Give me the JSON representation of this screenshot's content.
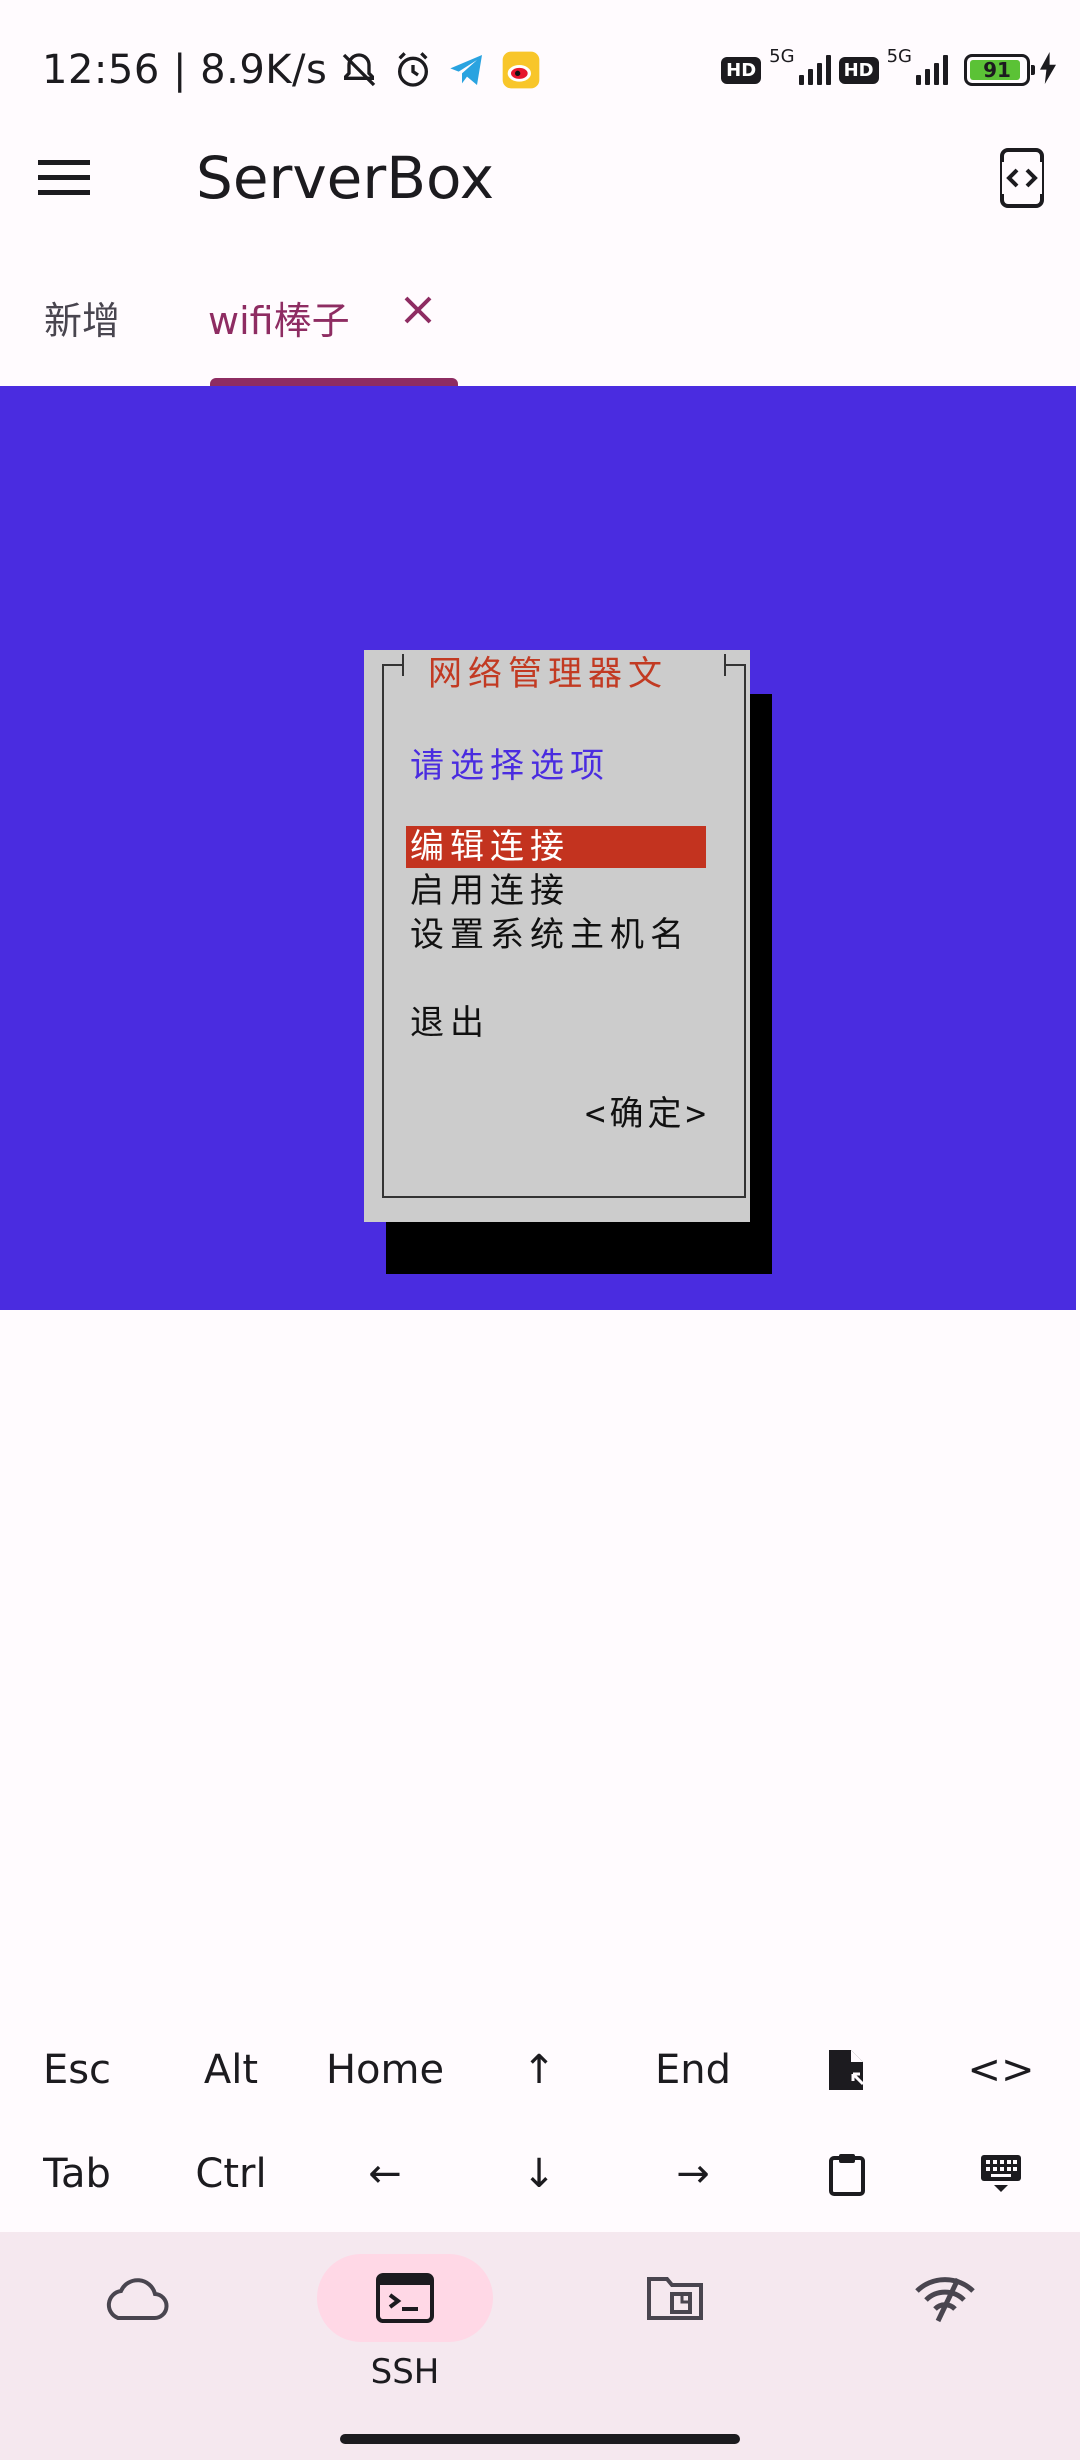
{
  "status_bar": {
    "time_speed": "12:56 | 8.9K/s",
    "network_1": "5G",
    "network_2": "5G",
    "hd_badge": "HD",
    "battery_level": "91",
    "battery_color": "#5bc236"
  },
  "app_bar": {
    "title": "ServerBox",
    "menu_icon": "menu-icon",
    "switch_icon": "code-phone-icon"
  },
  "tabs": [
    {
      "label": "新增"
    },
    {
      "label": "wifi棒子",
      "active": true
    }
  ],
  "terminal": {
    "background": "#4a2ce0",
    "dialog": {
      "title": "网络管理器文",
      "prompt": "请选择选项",
      "options": [
        "编辑连接",
        "启用连接",
        "设置系统主机名",
        "退出"
      ],
      "selected_index": 0,
      "ok_button": "<确定>"
    }
  },
  "extra_keys": {
    "row1": [
      "Esc",
      "Alt",
      "Home",
      "↑",
      "End",
      "file-icon",
      "<>"
    ],
    "row2": [
      "Tab",
      "Ctrl",
      "←",
      "↓",
      "→",
      "clipboard-icon",
      "keyboard-icon"
    ]
  },
  "bottom_nav": {
    "items": [
      {
        "icon": "cloud-icon",
        "label": ""
      },
      {
        "icon": "terminal-icon",
        "label": "SSH",
        "active": true
      },
      {
        "icon": "folder-icon",
        "label": ""
      },
      {
        "icon": "wifi-icon",
        "label": ""
      }
    ]
  },
  "colors": {
    "accent": "#8e2c62",
    "nav_bg": "#f5e8ef",
    "nav_active": "#ffd8e6",
    "dialog_bg": "#cccccc",
    "dialog_highlight": "#c3331f"
  }
}
